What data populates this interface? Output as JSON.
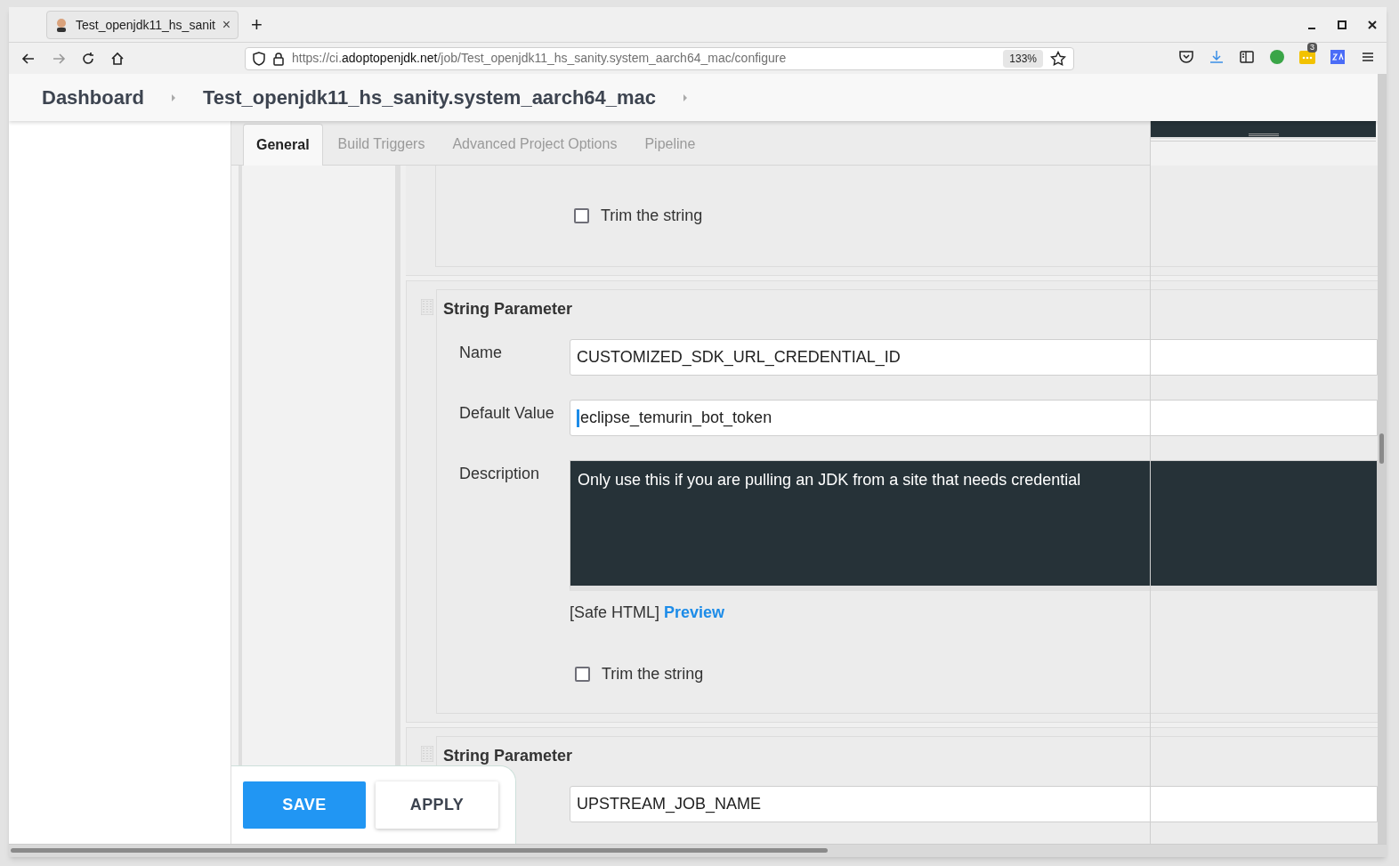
{
  "browser": {
    "tab_title": "Test_openjdk11_hs_sanit",
    "tab_close": "×",
    "new_tab": "+",
    "url_prefix": "https://ci.",
    "url_host": "adoptopenjdk.net",
    "url_path": "/job/Test_openjdk11_hs_sanity.system_aarch64_mac/configure",
    "zoom": "133%",
    "extension_badge": "3"
  },
  "breadcrumb": [
    "Dashboard",
    "Test_openjdk11_hs_sanity.system_aarch64_mac"
  ],
  "tabs": [
    {
      "label": "General",
      "selected": true
    },
    {
      "label": "Build Triggers",
      "selected": false
    },
    {
      "label": "Advanced Project Options",
      "selected": false
    },
    {
      "label": "Pipeline",
      "selected": false
    }
  ],
  "sections": [
    {
      "kind": "tail",
      "trim": {
        "label": "Trim the string",
        "checked": false
      }
    },
    {
      "kind": "full",
      "title": "String Parameter",
      "fields": [
        {
          "label": "Name",
          "value": "CUSTOMIZED_SDK_URL_CREDENTIAL_ID",
          "focused": false
        },
        {
          "label": "Default Value",
          "value": "eclipse_temurin_bot_token",
          "focused": true
        }
      ],
      "description": {
        "label": "Description",
        "value": "Only use this if you are pulling an JDK from a site that needs credential"
      },
      "safe_html": "[Safe HTML]",
      "preview": "Preview",
      "trim": {
        "label": "Trim the string",
        "checked": false
      }
    },
    {
      "kind": "partial",
      "title": "String Parameter",
      "name_value": "UPSTREAM_JOB_NAME"
    }
  ],
  "buttons": [
    {
      "label": "SAVE",
      "kind": "primary"
    },
    {
      "label": "APPLY",
      "kind": "secondary"
    }
  ]
}
